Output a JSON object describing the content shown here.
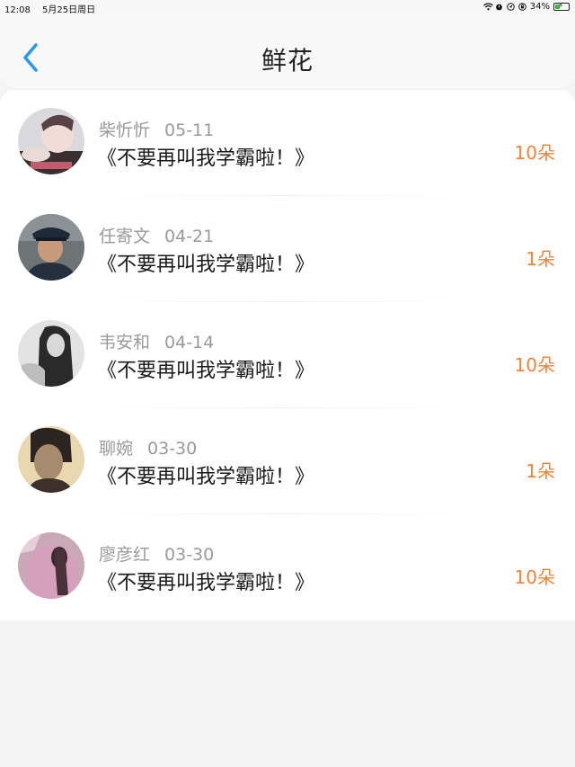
{
  "status_bar": {
    "time": "12:08",
    "date": "5月25日周日",
    "battery_percent": "34%",
    "battery_level": 0.34,
    "icons": [
      "wifi-icon",
      "alarm-icon",
      "location-icon",
      "lock-rotation-icon",
      "battery-icon"
    ]
  },
  "nav": {
    "back_icon": "chevron-left-icon",
    "title": "鲜花"
  },
  "colors": {
    "accent_blue": "#2a9af0",
    "count_orange": "#f0833a",
    "meta_gray": "#9a9a9a"
  },
  "items": [
    {
      "name": "柴忻忻",
      "date": "05-11",
      "message": "《不要再叫我学霸啦！》",
      "count": "10朵"
    },
    {
      "name": "任寄文",
      "date": "04-21",
      "message": "《不要再叫我学霸啦！》",
      "count": "1朵"
    },
    {
      "name": "韦安和",
      "date": "04-14",
      "message": "《不要再叫我学霸啦！》",
      "count": "10朵"
    },
    {
      "name": "聊婉",
      "date": "03-30",
      "message": "《不要再叫我学霸啦！》",
      "count": "1朵"
    },
    {
      "name": "廖彦红",
      "date": "03-30",
      "message": "《不要再叫我学霸啦！》",
      "count": "10朵"
    }
  ]
}
